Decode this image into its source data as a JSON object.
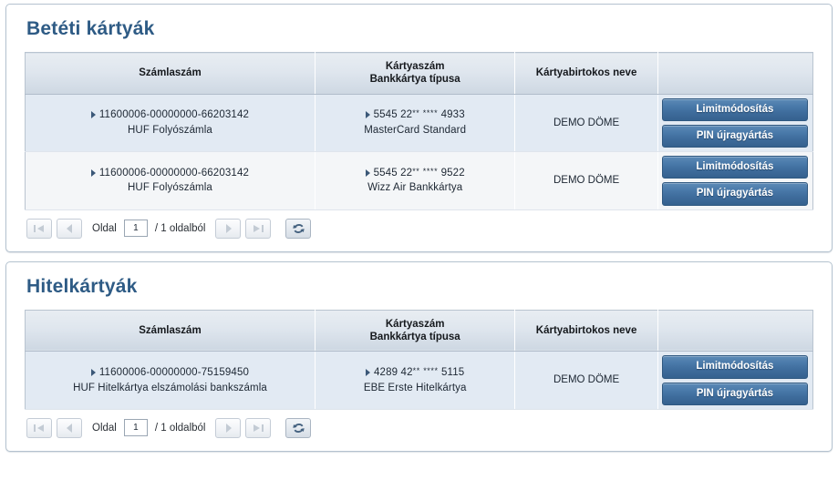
{
  "panels": [
    {
      "title": "Betéti kártyák",
      "columns": [
        "Számlaszám",
        "Kártyaszám\nBankkártya típusa",
        "Kártyabirtokos neve",
        ""
      ],
      "col_head_1": "Számlaszám",
      "col_head_2a": "Kártyaszám",
      "col_head_2b": "Bankkártya típusa",
      "col_head_3": "Kártyabirtokos neve",
      "rows": [
        {
          "account_number": "11600006-00000000-66203142",
          "account_type": "HUF Folyószámla",
          "card_number_prefix": "5545 22",
          "card_number_mask1": "**",
          "card_number_mask2": "****",
          "card_number_suffix": "4933",
          "card_type": "MasterCard Standard",
          "holder": "DEMO DÖME",
          "button_limit": "Limitmódosítás",
          "button_pin": "PIN újragyártás"
        },
        {
          "account_number": "11600006-00000000-66203142",
          "account_type": "HUF Folyószámla",
          "card_number_prefix": "5545 22",
          "card_number_mask1": "**",
          "card_number_mask2": "****",
          "card_number_suffix": "9522",
          "card_type": "Wizz Air Bankkártya",
          "holder": "DEMO DÖME",
          "button_limit": "Limitmódosítás",
          "button_pin": "PIN újragyártás"
        }
      ],
      "pager": {
        "label": "Oldal",
        "current_page": "1",
        "suffix": "/ 1 oldalból",
        "first_icon": "first-page-icon",
        "prev_icon": "previous-page-icon",
        "next_icon": "next-page-icon",
        "last_icon": "last-page-icon",
        "refresh_icon": "refresh-icon"
      }
    },
    {
      "title": "Hitelkártyák",
      "col_head_1": "Számlaszám",
      "col_head_2a": "Kártyaszám",
      "col_head_2b": "Bankkártya típusa",
      "col_head_3": "Kártyabirtokos neve",
      "rows": [
        {
          "account_number": "11600006-00000000-75159450",
          "account_type": "HUF Hitelkártya elszámolási bankszámla",
          "card_number_prefix": "4289 42",
          "card_number_mask1": "**",
          "card_number_mask2": "****",
          "card_number_suffix": "5115",
          "card_type": "EBE Erste Hitelkártya",
          "holder": "DEMO DÖME",
          "button_limit": "Limitmódosítás",
          "button_pin": "PIN újragyártás"
        }
      ],
      "pager": {
        "label": "Oldal",
        "current_page": "1",
        "suffix": "/ 1 oldalból",
        "first_icon": "first-page-icon",
        "prev_icon": "previous-page-icon",
        "next_icon": "next-page-icon",
        "last_icon": "last-page-icon",
        "refresh_icon": "refresh-icon"
      }
    }
  ],
  "colors": {
    "title": "#2e5b85",
    "button": "#42739f",
    "header_bg": "#dde5ee",
    "row_odd": "#e2eaf3",
    "row_even": "#f4f6f8",
    "panel_border": "#b4c2cf"
  }
}
